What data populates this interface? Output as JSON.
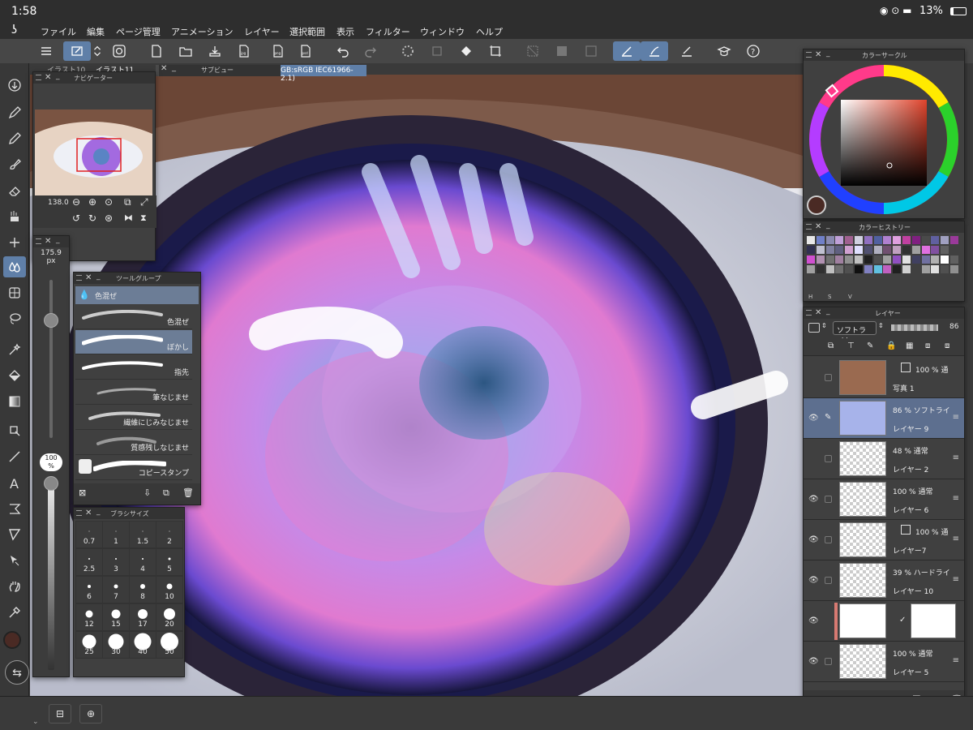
{
  "status": {
    "time": "1:58",
    "battery": "13%"
  },
  "menu": [
    "ファイル",
    "編集",
    "ページ管理",
    "アニメーション",
    "レイヤー",
    "選択範囲",
    "表示",
    "フィルター",
    "ウィンドウ",
    "ヘルプ"
  ],
  "tabs": {
    "tab1": "イラスト10",
    "tab2": "イラスト11",
    "profile": "GB:sRGB IEC61966-2.1)"
  },
  "navigator": {
    "title": "ナビゲーター",
    "zoom": "138.0"
  },
  "subview": {
    "title": "サブビュー"
  },
  "brush_size_slider": {
    "value": "175.9",
    "unit": "px",
    "opacity": "100",
    "opacity_unit": "%"
  },
  "tool_group": {
    "title": "ツールグループ",
    "header": "色混ぜ",
    "brushes": [
      "色混ぜ",
      "ぼかし",
      "指先",
      "筆なじませ",
      "繊維にじみなじませ",
      "質感残しなじませ",
      "コピースタンプ"
    ],
    "selected": "ぼかし"
  },
  "brush_size_panel": {
    "title": "ブラシサイズ",
    "sizes": [
      "0.7",
      "1",
      "1.5",
      "2",
      "2.5",
      "3",
      "4",
      "5",
      "6",
      "7",
      "8",
      "10",
      "12",
      "15",
      "17",
      "20",
      "25",
      "30",
      "40",
      "50"
    ]
  },
  "color_circle": {
    "title": "カラーサークル",
    "current_color": "#4a2a24",
    "square_hue": "#e0442c"
  },
  "color_history": {
    "title": "カラーヒストリー",
    "footer": [
      "H",
      "S",
      "V"
    ]
  },
  "layers_panel": {
    "title": "レイヤー",
    "blend_mode": "ソフトライト",
    "opacity": "86",
    "layers": [
      {
        "mode": "100 % 通",
        "name": "写真 1"
      },
      {
        "mode": "86 % ソフトライ",
        "name": "レイヤー 9"
      },
      {
        "mode": "48 % 通常",
        "name": "レイヤー 2"
      },
      {
        "mode": "100 % 通常",
        "name": "レイヤー 6"
      },
      {
        "mode": "100 % 通",
        "name": "レイヤー7"
      },
      {
        "mode": "39 % ハードライ",
        "name": "レイヤー 10"
      },
      {
        "mode": "",
        "name": ""
      },
      {
        "mode": "100 % 通常",
        "name": "レイヤー 5"
      }
    ]
  },
  "colors": {
    "accent": "#5f7fa8",
    "panel": "#404040",
    "titlebar": "#333333"
  }
}
